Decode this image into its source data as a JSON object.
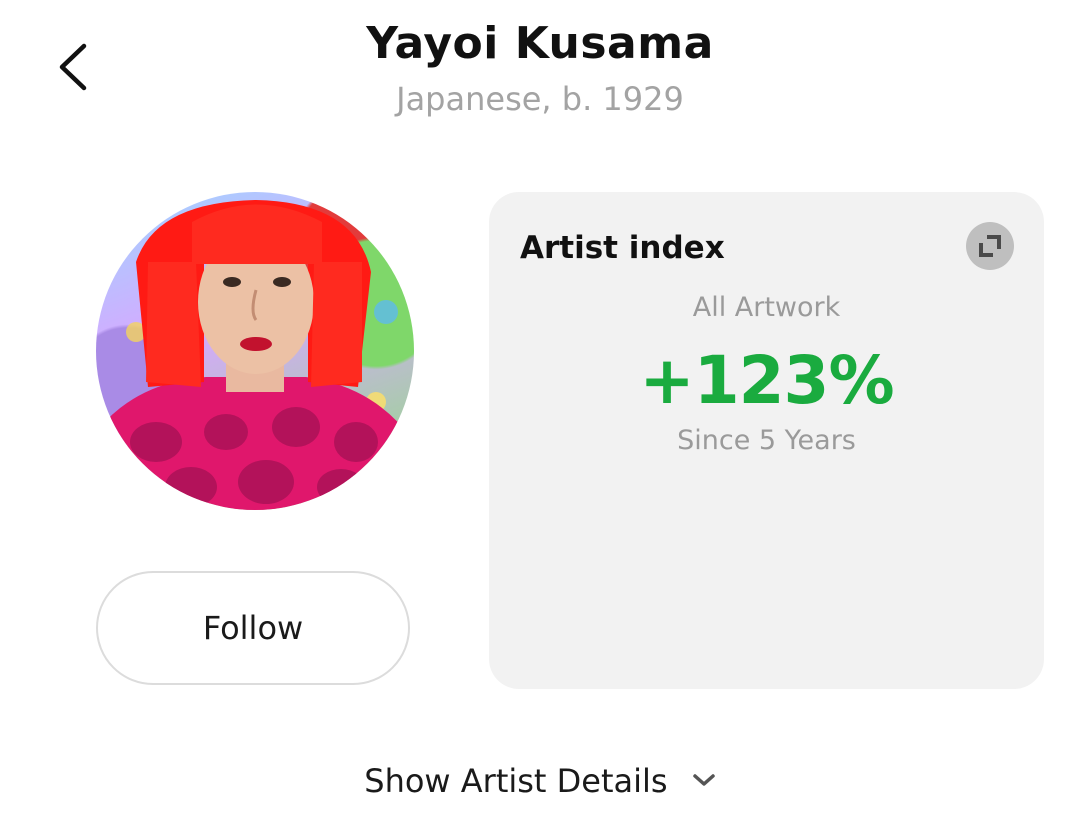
{
  "header": {
    "title": "Yayoi Kusama",
    "subtitle": "Japanese, b. 1929",
    "back_icon": "chevron-left-icon"
  },
  "profile": {
    "avatar_icon": "artist-portrait",
    "follow_label": "Follow"
  },
  "artist_index": {
    "title": "Artist index",
    "expand_icon": "expand-icon",
    "scope_label": "All Artwork",
    "change_value": "+123%",
    "period_label": "Since 5 Years",
    "accent_color": "#1aab3f"
  },
  "footer": {
    "details_label": "Show Artist Details",
    "details_icon": "chevron-down-icon"
  }
}
